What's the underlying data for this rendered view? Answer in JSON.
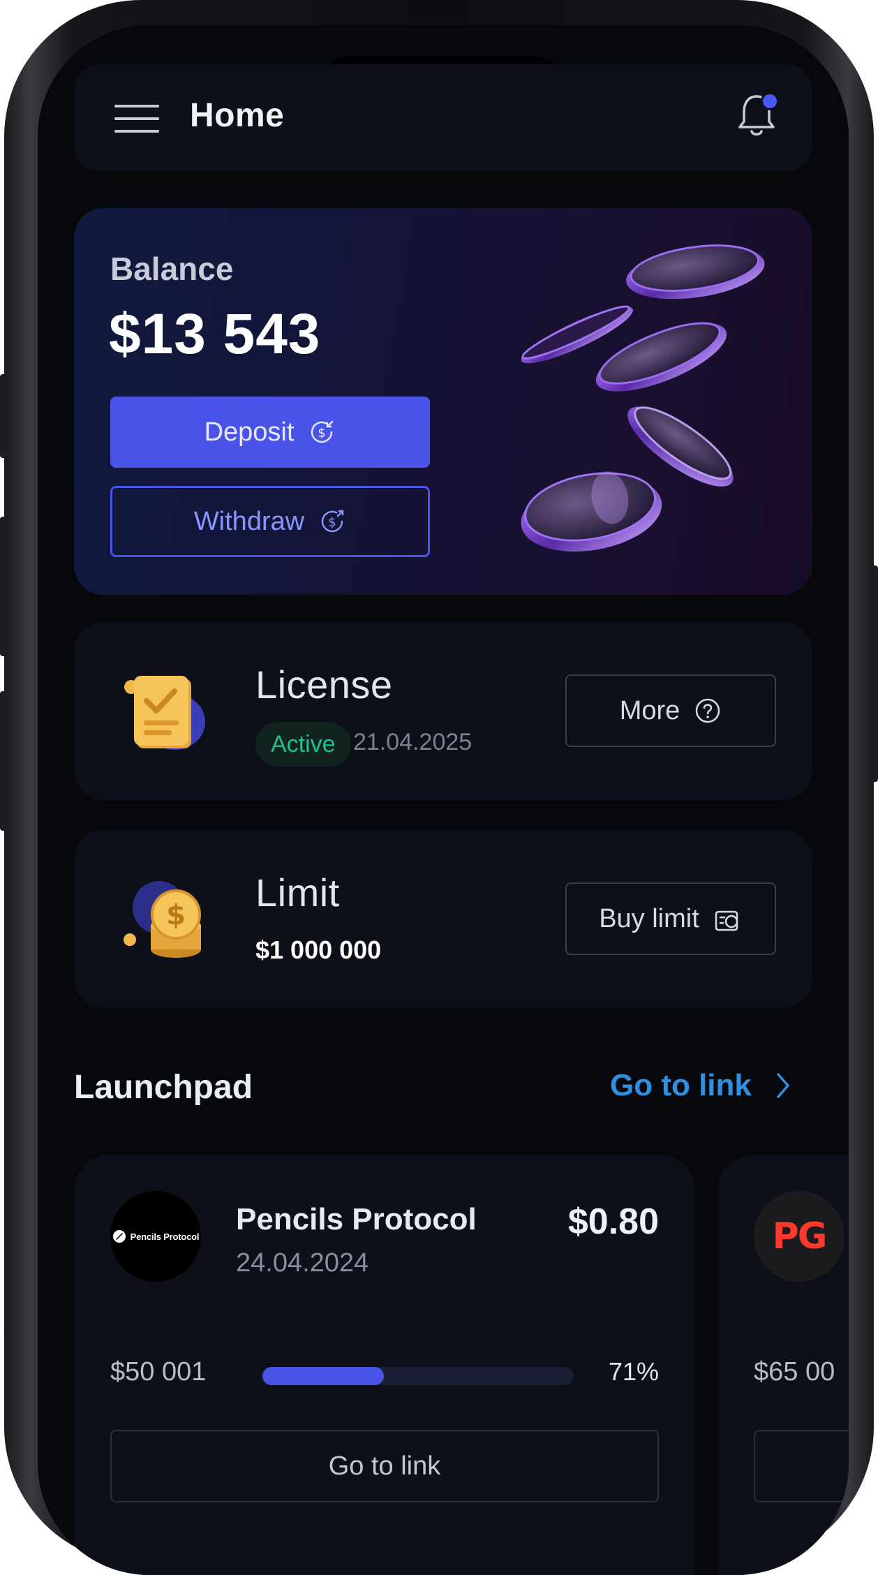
{
  "header": {
    "title": "Home"
  },
  "balance": {
    "label": "Balance",
    "amount": "$13 543",
    "deposit_label": "Deposit",
    "withdraw_label": "Withdraw"
  },
  "license": {
    "title": "License",
    "status": "Active",
    "date": "21.04.2025",
    "button_label": "More"
  },
  "limit": {
    "title": "Limit",
    "value": "$1 000 000",
    "button_label": "Buy limit"
  },
  "launchpad": {
    "title": "Launchpad",
    "link_label": "Go to link",
    "projects": [
      {
        "logo_text": "Pencils Protocol",
        "name": "Pencils Protocol",
        "date": "24.04.2024",
        "price": "$0.80",
        "raised": "$50 001",
        "progress_percent": 71,
        "progress_label": "71%",
        "button_label": "Go to link"
      },
      {
        "logo_text": "PG",
        "raised": "$65 00"
      }
    ]
  },
  "colors": {
    "background": "#07080b",
    "card": "#0e1019",
    "accent": "#4a53e8",
    "link": "#2f8fe0",
    "success": "#1ec08e",
    "notification_dot": "#4b57f5"
  }
}
